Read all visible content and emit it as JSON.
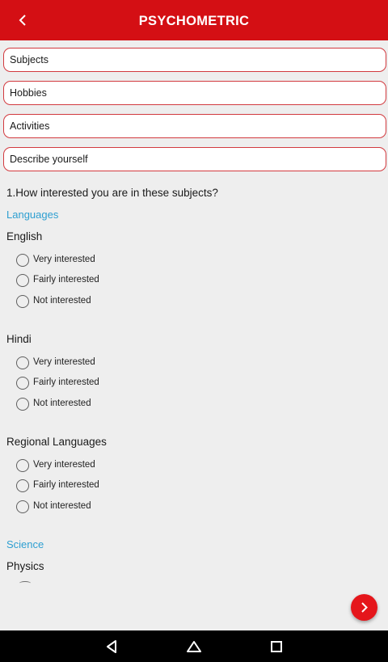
{
  "appbar": {
    "title": "PSYCHOMETRIC",
    "back_icon": "chevron-left-icon"
  },
  "tabs": [
    {
      "label": "Subjects"
    },
    {
      "label": "Hobbies"
    },
    {
      "label": "Activities"
    },
    {
      "label": "Describe yourself"
    }
  ],
  "question": "1.How interested you are in these subjects?",
  "categories": {
    "languages": "Languages",
    "science": "Science"
  },
  "subjects": {
    "english": "English",
    "hindi": "Hindi",
    "regional": "Regional Languages",
    "physics": "Physics"
  },
  "options": [
    "Very interested",
    "Fairly interested",
    "Not interested"
  ],
  "fab": {
    "icon": "chevron-right-icon"
  },
  "navbar": {
    "icons": [
      "back-triangle-icon",
      "home-icon",
      "recents-icon"
    ]
  },
  "colors": {
    "accent": "#d40f14",
    "category": "#2e9fd1",
    "field_border": "#d23a3f"
  }
}
